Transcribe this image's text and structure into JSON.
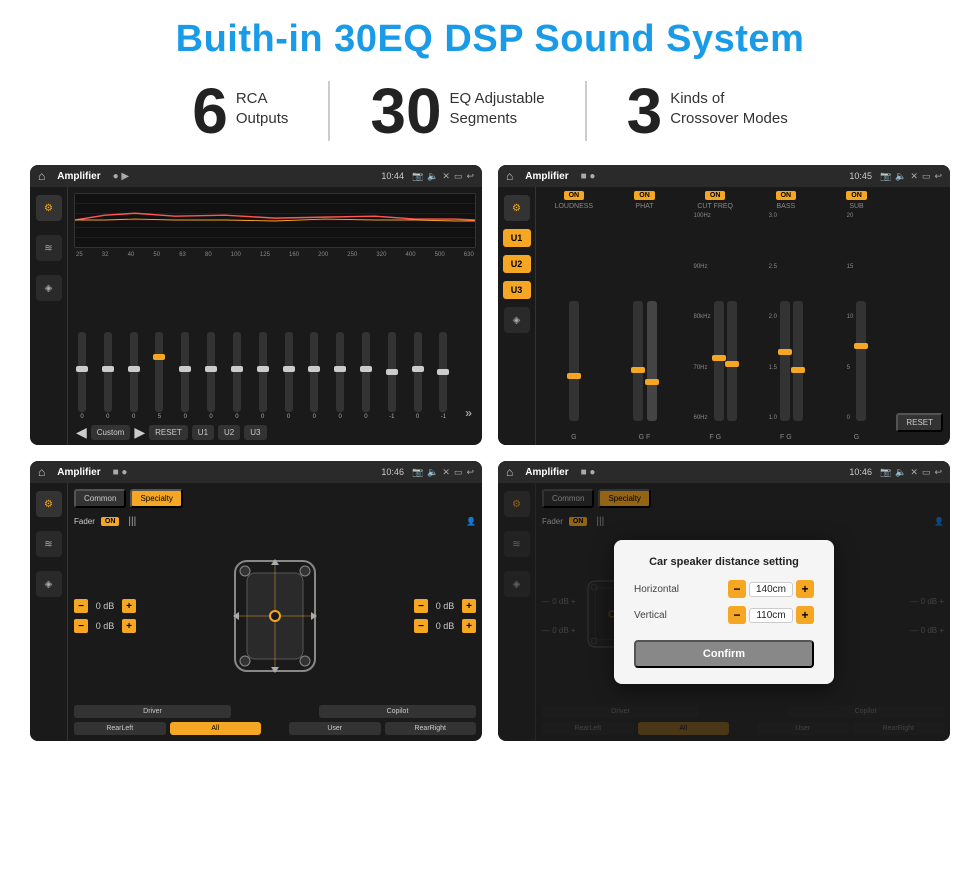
{
  "title": "Buith-in 30EQ DSP Sound System",
  "stats": [
    {
      "number": "6",
      "line1": "RCA",
      "line2": "Outputs"
    },
    {
      "number": "30",
      "line1": "EQ Adjustable",
      "line2": "Segments"
    },
    {
      "number": "3",
      "line1": "Kinds of",
      "line2": "Crossover Modes"
    }
  ],
  "screens": [
    {
      "topbar": {
        "title": "Amplifier",
        "time": "10:44"
      },
      "type": "eq"
    },
    {
      "topbar": {
        "title": "Amplifier",
        "time": "10:45"
      },
      "type": "crossover"
    },
    {
      "topbar": {
        "title": "Amplifier",
        "time": "10:46"
      },
      "type": "fader"
    },
    {
      "topbar": {
        "title": "Amplifier",
        "time": "10:46"
      },
      "type": "dialog"
    }
  ],
  "eq": {
    "freqs": [
      "25",
      "32",
      "40",
      "50",
      "63",
      "80",
      "100",
      "125",
      "160",
      "200",
      "250",
      "320",
      "400",
      "500",
      "630"
    ],
    "values": [
      "0",
      "0",
      "0",
      "5",
      "0",
      "0",
      "0",
      "0",
      "0",
      "0",
      "0",
      "0",
      "-1",
      "0",
      "-1"
    ],
    "buttons": [
      "Custom",
      "RESET",
      "U1",
      "U2",
      "U3"
    ]
  },
  "crossover": {
    "units": [
      "U1",
      "U2",
      "U3"
    ],
    "channels": [
      "LOUDNESS",
      "PHAT",
      "CUT FREQ",
      "BASS",
      "SUB"
    ],
    "reset_label": "RESET"
  },
  "fader": {
    "tabs": [
      "Common",
      "Specialty"
    ],
    "fader_label": "Fader",
    "on_label": "ON",
    "controls": [
      {
        "label": "0 dB"
      },
      {
        "label": "0 dB"
      },
      {
        "label": "0 dB"
      },
      {
        "label": "0 dB"
      }
    ],
    "bottom_buttons": [
      "Driver",
      "",
      "Copilot",
      "RearLeft",
      "All",
      "",
      "User",
      "RearRight"
    ]
  },
  "dialog": {
    "title": "Car speaker distance setting",
    "horizontal_label": "Horizontal",
    "horizontal_value": "140cm",
    "vertical_label": "Vertical",
    "vertical_value": "110cm",
    "confirm_label": "Confirm",
    "db_right1": "0 dB",
    "db_right2": "0 dB"
  }
}
